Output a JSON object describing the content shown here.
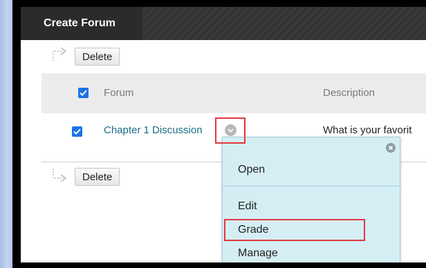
{
  "toolbar": {
    "create_forum_label": "Create Forum"
  },
  "actions": {
    "delete_label": "Delete"
  },
  "table": {
    "columns": [
      "Forum",
      "Description"
    ],
    "rows": [
      {
        "forum": "Chapter 1 Discussion",
        "description": "What is your favorit"
      }
    ]
  },
  "context_menu": {
    "items": [
      "Open",
      "Edit",
      "Grade",
      "Manage"
    ]
  },
  "colors": {
    "toolbar": "#333333",
    "link": "#1a6e86",
    "checkbox": "#1a73e8",
    "menu_bg": "#d5eef4",
    "highlight": "#e0383e"
  }
}
